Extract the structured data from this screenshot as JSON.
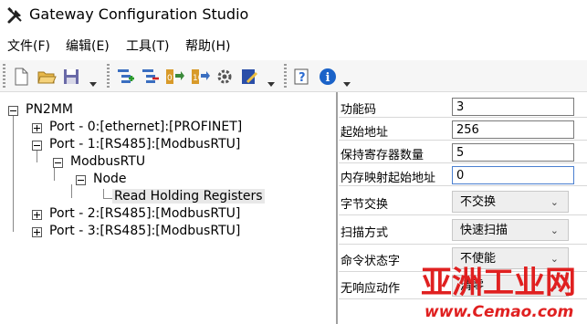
{
  "window": {
    "title": "Gateway Configuration Studio",
    "icon": "tools-icon"
  },
  "menu": [
    {
      "label": "文件(F)"
    },
    {
      "label": "编辑(E)"
    },
    {
      "label": "工具(T)"
    },
    {
      "label": "帮助(H)"
    }
  ],
  "toolbar": {
    "icons": [
      "new-document-icon",
      "open-folder-icon",
      "save-icon",
      "add-node-icon",
      "remove-node-icon",
      "import-icon",
      "export-icon",
      "settings-gear-icon",
      "edit-note-icon",
      "help-icon",
      "info-icon"
    ]
  },
  "tree": {
    "root": "PN2MM",
    "port0": "Port - 0:[ethernet]:[PROFINET]",
    "port1": "Port - 1:[RS485]:[ModbusRTU]",
    "modbus": "ModbusRTU",
    "node": "Node",
    "read_holding": "Read Holding Registers",
    "port2": "Port - 2:[RS485]:[ModbusRTU]",
    "port3": "Port - 3:[RS485]:[ModbusRTU]"
  },
  "properties": {
    "function_code": {
      "label": "功能码",
      "value": "3"
    },
    "start_address": {
      "label": "起始地址",
      "value": "256"
    },
    "register_count": {
      "label": "保持寄存器数量",
      "value": "5"
    },
    "memory_start": {
      "label": "内存映射起始地址",
      "value": "0"
    },
    "byte_swap": {
      "label": "字节交换",
      "value": "不交换"
    },
    "scan_mode": {
      "label": "扫描方式",
      "value": "快速扫描"
    },
    "cmd_status_word": {
      "label": "命令状态字",
      "value": "不使能"
    },
    "no_response_action": {
      "label": "无响应动作",
      "value": "清零"
    }
  },
  "watermark": {
    "line1": "亚洲工业网",
    "line2": "www.Cemao.com"
  },
  "colors": {
    "selection": "#e8e8e8",
    "watermark_red": "#e02020"
  }
}
